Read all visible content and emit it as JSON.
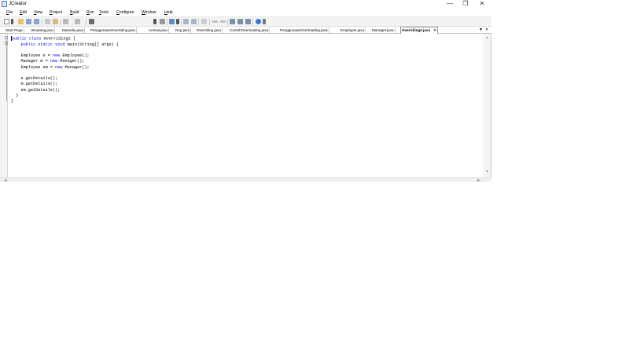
{
  "window": {
    "title": "JCreator",
    "minimize": "—",
    "restore": "❐",
    "close": "✕"
  },
  "menu": {
    "items": [
      {
        "label": "File",
        "mnemonic": "F",
        "rest": "ile"
      },
      {
        "label": "Edit",
        "mnemonic": "E",
        "rest": "dit"
      },
      {
        "label": "View",
        "mnemonic": "V",
        "rest": "iew"
      },
      {
        "label": "Project",
        "mnemonic": "P",
        "rest": "roject"
      },
      {
        "label": "Build",
        "mnemonic": "B",
        "rest": "uild"
      },
      {
        "label": "Run",
        "mnemonic": "R",
        "rest": "un"
      },
      {
        "label": "Tools",
        "mnemonic": "T",
        "rest": "ools"
      },
      {
        "label": "Configure",
        "mnemonic": "C",
        "rest": "onfigure"
      },
      {
        "label": "Window",
        "mnemonic": "W",
        "rest": "indow"
      },
      {
        "label": "Help",
        "mnemonic": "H",
        "rest": "elp"
      }
    ]
  },
  "toolbar": {
    "icons": [
      "new-icon",
      "open-icon",
      "save-icon",
      "save-all-icon",
      "copy-icon",
      "paste-icon",
      "undo-icon",
      "redo-icon",
      "find-icon",
      "build-icon",
      "run-icon",
      "indent-icon",
      "outdent-icon",
      "comment-icon",
      "back-icon",
      "forward-icon",
      "window-icon",
      "help-icon"
    ]
  },
  "tabs": {
    "items": [
      {
        "label": "Start Page",
        "active": false
      },
      {
        "label": "Binatang.java",
        "active": false
      },
      {
        "label": "Mamalia.java",
        "active": false
      },
      {
        "label": "PenggunaanOverriding.java",
        "active": false
      },
      {
        "label": "Animal.java",
        "active": false
      },
      {
        "label": "Dog.java",
        "active": false
      },
      {
        "label": "Overriding.java",
        "active": false
      },
      {
        "label": "ContohOverloading.java",
        "active": false
      },
      {
        "label": "PenggunaanOverloading.java",
        "active": false
      },
      {
        "label": "Employee.java",
        "active": false
      },
      {
        "label": "Manager.java",
        "active": false
      },
      {
        "label": "Overriding2.java",
        "active": true
      }
    ],
    "close_active": "✕",
    "dropdown": "▼",
    "close_all": "✕"
  },
  "editor": {
    "lines": [
      "public class Overriding2 {",
      "    public static void main(String[] args) {",
      "",
      "    Employee e = new Employee();",
      "    Manager m = new Manager();",
      "    Employee em = new Manager();",
      "",
      "    e.getDetails();",
      "    m.getDetails();",
      "    em.getDetails();",
      "  }",
      "}"
    ]
  },
  "colors": {
    "keyword": "#0000ff",
    "text": "#000000",
    "gutter": "#f4f4f4",
    "toolbar": "#f3f3f3"
  }
}
